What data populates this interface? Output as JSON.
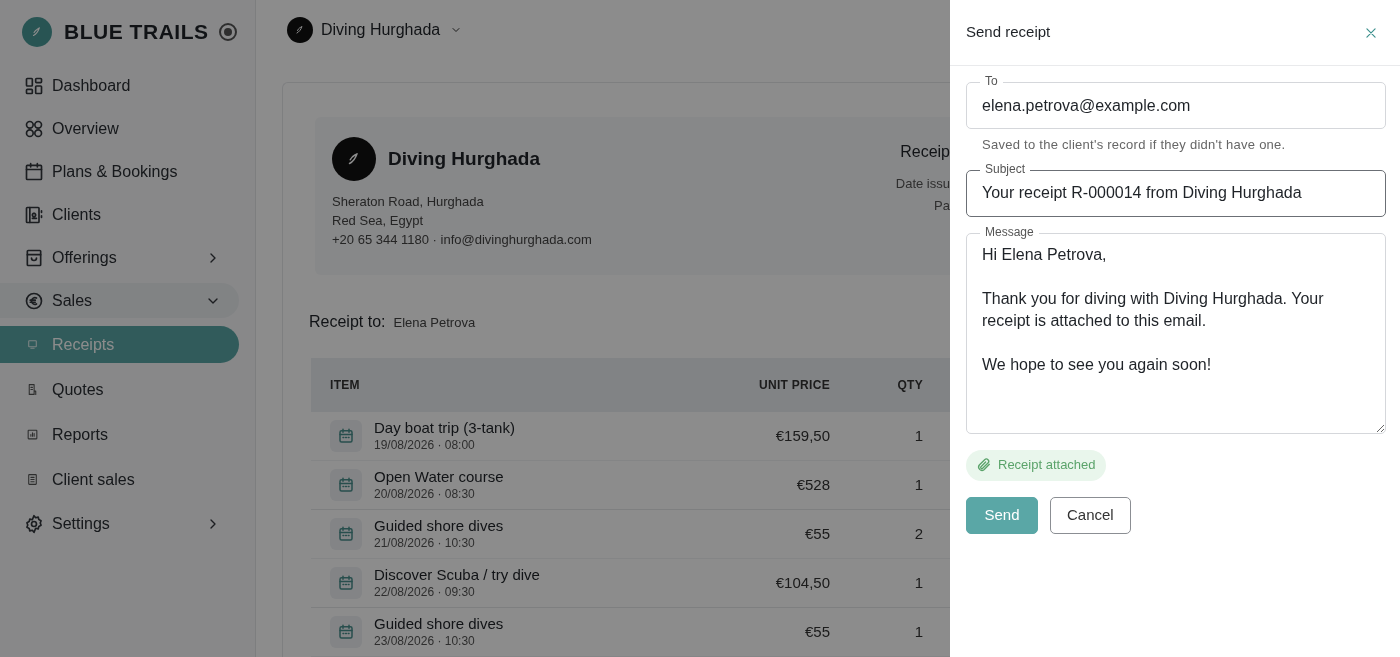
{
  "sidebar": {
    "brand": "BLUE TRAILS",
    "items": [
      {
        "kind": "item",
        "label": "Dashboard"
      },
      {
        "kind": "item",
        "label": "Overview"
      },
      {
        "kind": "item",
        "label": "Plans & Bookings"
      },
      {
        "kind": "item",
        "label": "Clients"
      },
      {
        "kind": "group",
        "label": "Offerings",
        "expanded": false
      },
      {
        "kind": "group",
        "label": "Sales",
        "expanded": true,
        "children": [
          {
            "label": "Receipts",
            "selected": true
          },
          {
            "label": "Quotes",
            "selected": false
          },
          {
            "label": "Reports",
            "selected": false
          },
          {
            "label": "Client sales",
            "selected": false
          }
        ]
      },
      {
        "kind": "group",
        "label": "Settings",
        "expanded": false
      }
    ]
  },
  "topbar": {
    "business": "Diving Hurghada"
  },
  "receipt": {
    "company": "Diving Hurghada",
    "address_lines": [
      "Sheraton Road, Hurghada",
      "Red Sea, Egypt",
      "+20 65 344 1180 · info@divinghurghada.com"
    ],
    "meta_title": "Receip",
    "meta_lines": [
      "Date issu",
      "Pa"
    ],
    "receipt_to_label": "Receipt to:",
    "receipt_to": "Elena Petrova",
    "table": {
      "columns": [
        "ITEM",
        "UNIT PRICE",
        "QTY"
      ],
      "rows": [
        {
          "name": "Day boat trip (3-tank)",
          "date": "19/08/2026 · 08:00",
          "unit_price": "€159,50",
          "qty": "1"
        },
        {
          "name": "Open Water course",
          "date": "20/08/2026 · 08:30",
          "unit_price": "€528",
          "qty": "1"
        },
        {
          "name": "Guided shore dives",
          "date": "21/08/2026 · 10:30",
          "unit_price": "€55",
          "qty": "2"
        },
        {
          "name": "Discover Scuba / try dive",
          "date": "22/08/2026 · 09:30",
          "unit_price": "€104,50",
          "qty": "1"
        },
        {
          "name": "Guided shore dives",
          "date": "23/08/2026 · 10:30",
          "unit_price": "€55",
          "qty": "1"
        }
      ]
    }
  },
  "drawer": {
    "title": "Send receipt",
    "to": {
      "label": "To",
      "value": "elena.petrova@example.com",
      "helper": "Saved to the client's record if they didn't have one.",
      "focused": false
    },
    "subject": {
      "label": "Subject",
      "value": "Your receipt R-000014 from Diving Hurghada",
      "focused": true
    },
    "message": {
      "label": "Message",
      "value": "Hi Elena Petrova,\n\nThank you for diving with Diving Hurghada. Your receipt is attached to this email.\n\nWe hope to see you again soon!",
      "focused": false
    },
    "attachment": "Receipt attached",
    "buttons": [
      {
        "kind": "primary",
        "label": "Send"
      },
      {
        "kind": "secondary",
        "label": "Cancel"
      }
    ]
  }
}
